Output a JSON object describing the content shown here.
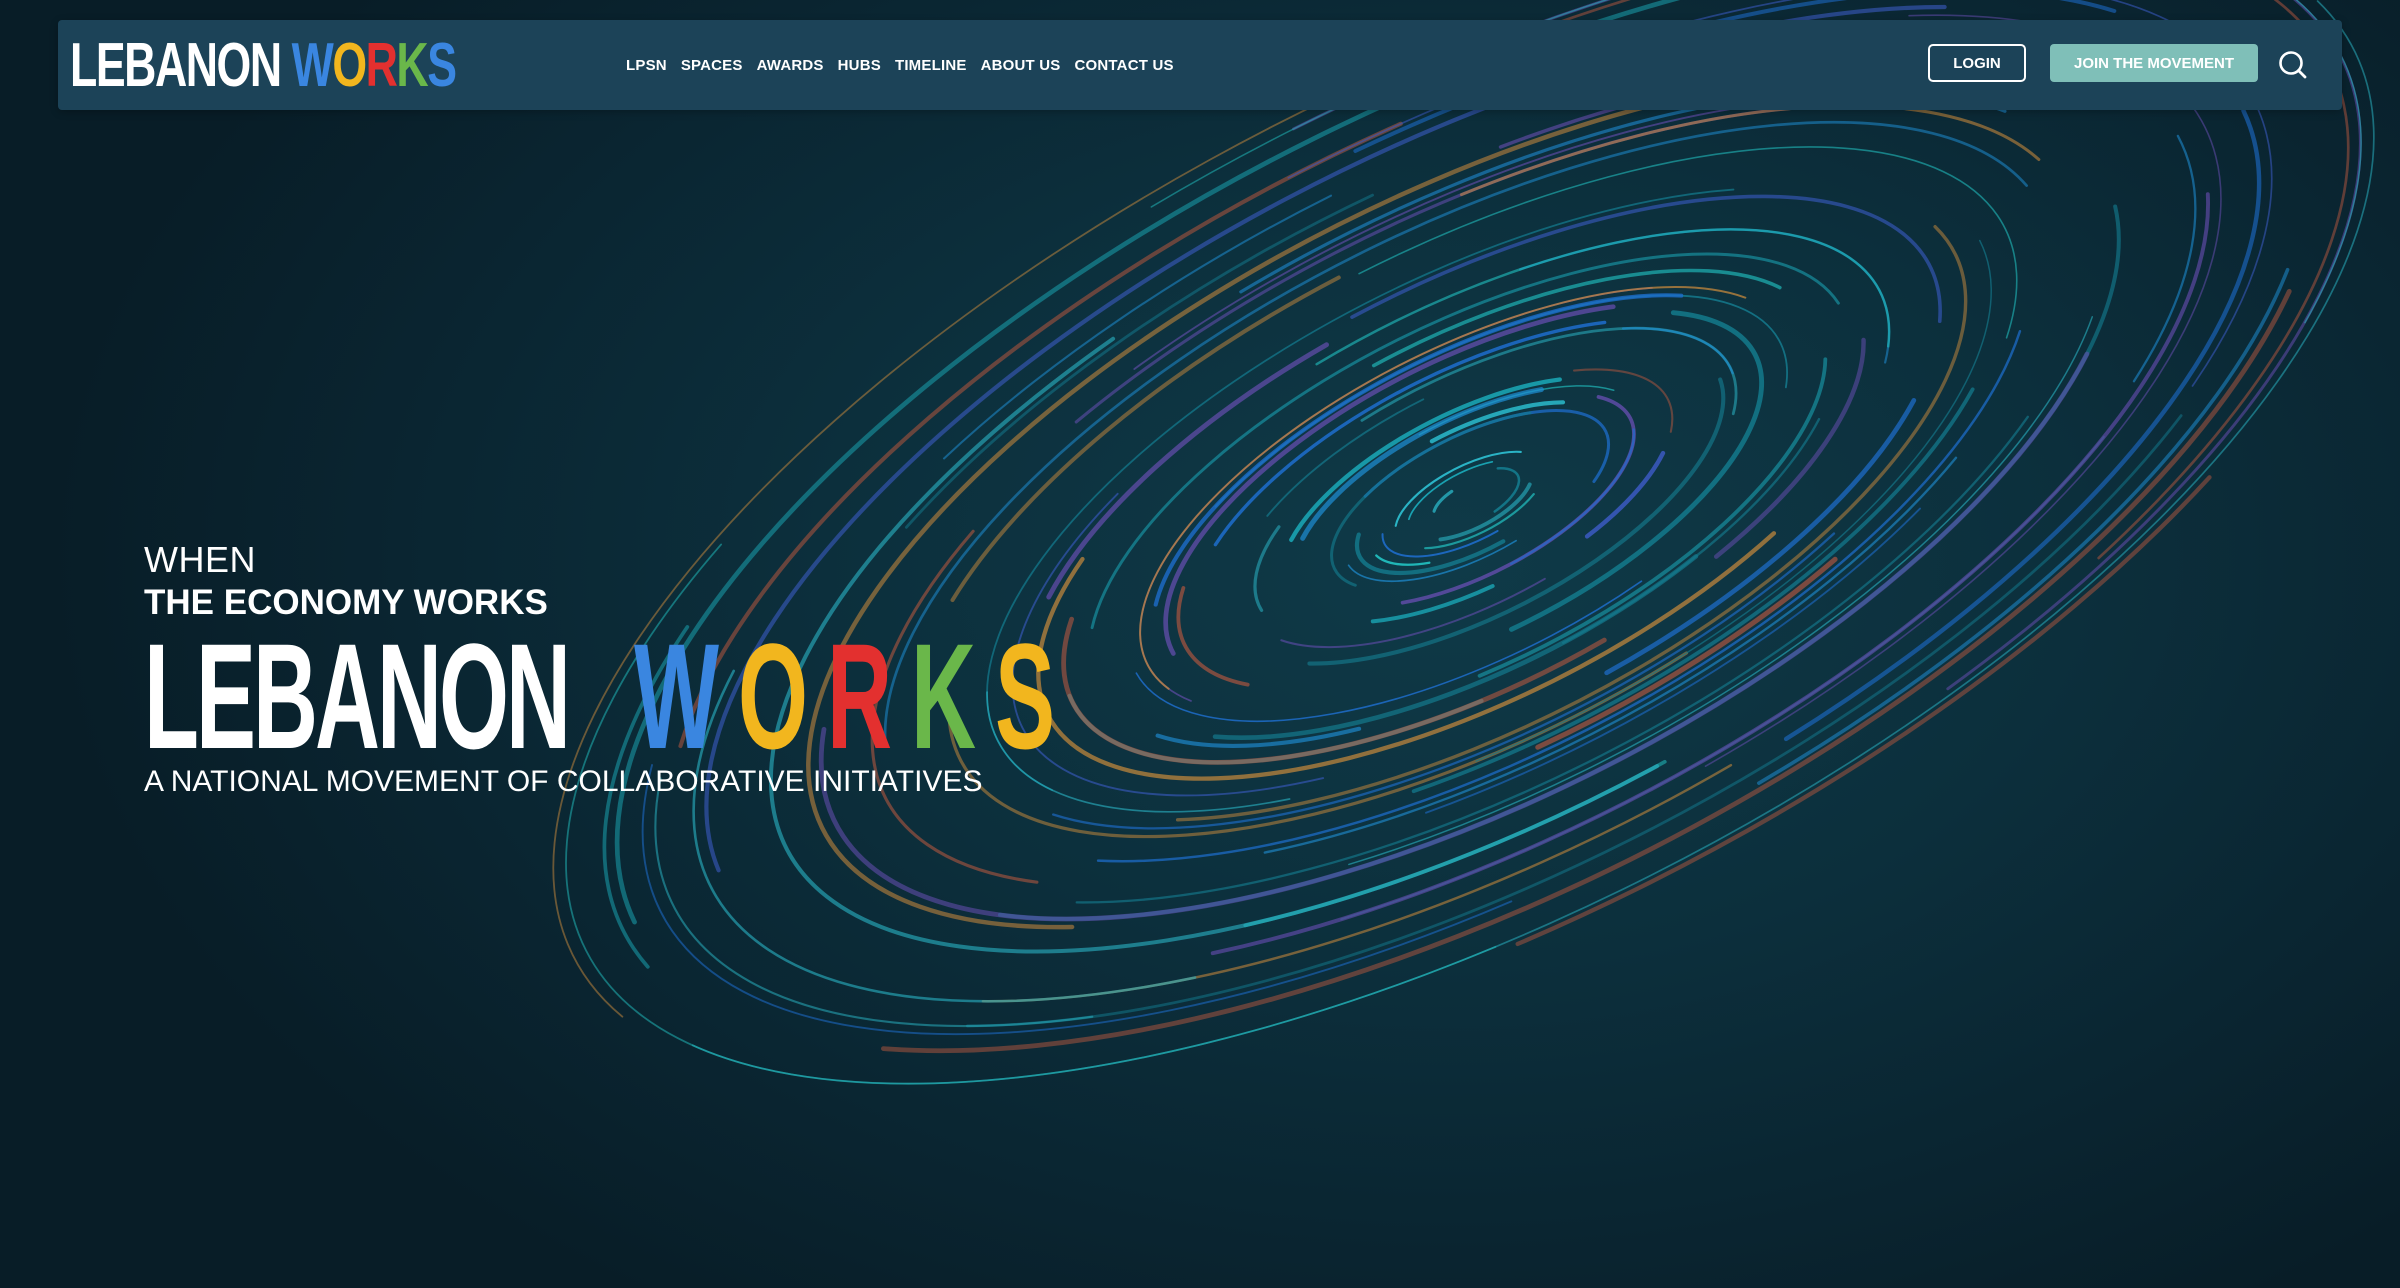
{
  "colors": {
    "background": "#0c2a35",
    "navbar": "#1c4358",
    "join_button": "#7fbfb8",
    "text": "#ffffff",
    "works_letters": [
      "#3a86e0",
      "#e3302f",
      "#f2b61e",
      "#3a86e0",
      "#6ab74a",
      "#e3302f",
      "#f2b61e",
      "#3a86e0",
      "#6ab74a"
    ]
  },
  "nav": {
    "logo": {
      "part1": "LEBANON",
      "part2_letters": [
        "W",
        "O",
        "R",
        "K",
        "S"
      ]
    },
    "links": [
      "LPSN",
      "SPACES",
      "AWARDS",
      "HUBS",
      "TIMELINE",
      "ABOUT US",
      "CONTACT US"
    ],
    "login_label": "LOGIN",
    "join_label": "JOIN THE MOVEMENT",
    "search_icon": "search-icon"
  },
  "hero": {
    "line1": "WHEN",
    "line2": "THE ECONOMY WORKS",
    "logo_part1": "LEBANON",
    "logo_part2_letters": [
      "W",
      "O",
      "R",
      "K",
      "S"
    ],
    "tagline": "A NATIONAL MOVEMENT OF COLLABORATIVE INITIATIVES"
  }
}
